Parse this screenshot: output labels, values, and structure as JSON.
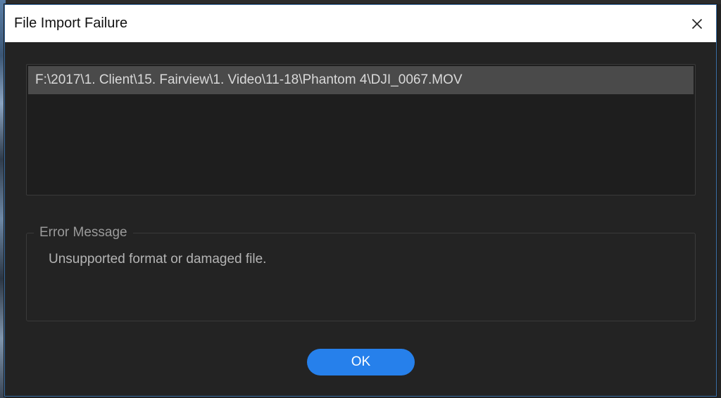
{
  "dialog": {
    "title": "File Import Failure",
    "close_icon": "close-icon"
  },
  "file_list": {
    "items": [
      "F:\\2017\\1. Client\\15. Fairview\\1. Video\\11-18\\Phantom 4\\DJI_0067.MOV"
    ]
  },
  "error": {
    "legend": "Error Message",
    "message": "Unsupported format or damaged file."
  },
  "buttons": {
    "ok_label": "OK"
  },
  "colors": {
    "accent": "#2680eb",
    "dialog_background": "#232323",
    "selected_row": "#4a4a4a"
  }
}
